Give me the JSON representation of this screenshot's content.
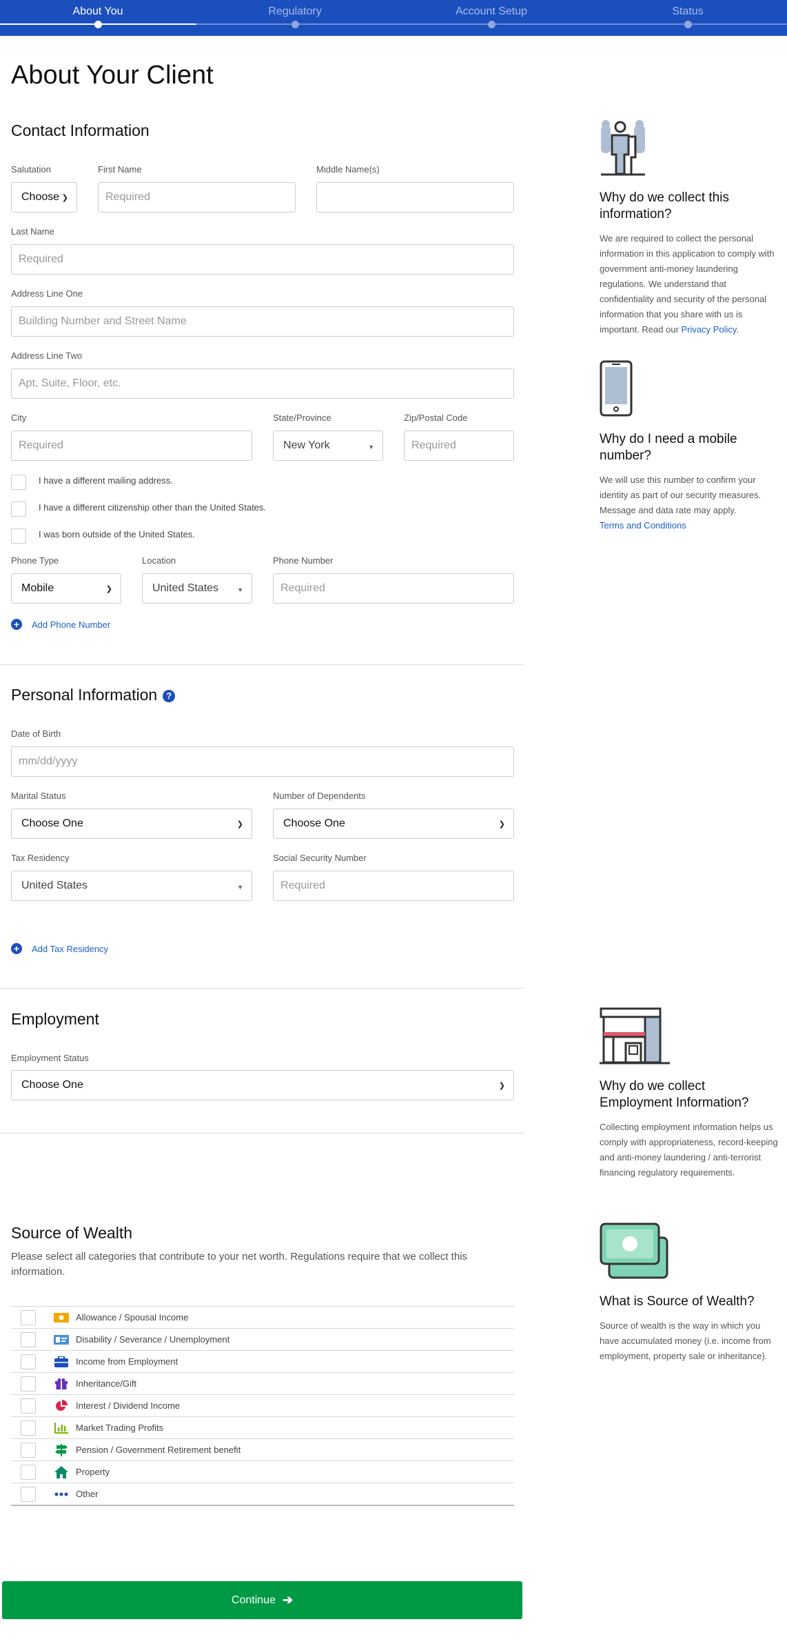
{
  "stepper": {
    "steps": [
      {
        "label": "About You",
        "active": true
      },
      {
        "label": "Regulatory",
        "active": false
      },
      {
        "label": "Account Setup",
        "active": false
      },
      {
        "label": "Status",
        "active": false
      }
    ]
  },
  "page_title": "About Your Client",
  "contact": {
    "title": "Contact Information",
    "salutation": {
      "label": "Salutation",
      "value": "Choose"
    },
    "first_name": {
      "label": "First Name",
      "placeholder": "Required"
    },
    "middle_name": {
      "label": "Middle Name(s)",
      "placeholder": ""
    },
    "last_name": {
      "label": "Last Name",
      "placeholder": "Required"
    },
    "address1": {
      "label": "Address Line One",
      "placeholder": "Building Number and Street Name"
    },
    "address2": {
      "label": "Address Line Two",
      "placeholder": "Apt, Suite, Floor, etc."
    },
    "city": {
      "label": "City",
      "placeholder": "Required"
    },
    "state": {
      "label": "State/Province",
      "value": "New York"
    },
    "zip": {
      "label": "Zip/Postal Code",
      "placeholder": "Required"
    },
    "checkboxes": [
      "I have a different mailing address.",
      "I have a different citizenship other than the United States.",
      "I was born outside of the United States."
    ],
    "phone_type": {
      "label": "Phone Type",
      "value": "Mobile"
    },
    "location": {
      "label": "Location",
      "value": "United States"
    },
    "phone_number": {
      "label": "Phone Number",
      "placeholder": "Required"
    },
    "add_phone": "Add Phone Number"
  },
  "personal": {
    "title": "Personal Information",
    "help_glyph": "?",
    "dob": {
      "label": "Date of Birth",
      "placeholder": "mm/dd/yyyy"
    },
    "marital": {
      "label": "Marital Status",
      "value": "Choose One"
    },
    "dependents": {
      "label": "Number of Dependents",
      "value": "Choose One"
    },
    "tax_residency": {
      "label": "Tax Residency",
      "value": "United States"
    },
    "ssn": {
      "label": "Social Security Number",
      "placeholder": "Required"
    },
    "add_tax": "Add Tax Residency"
  },
  "employment": {
    "title": "Employment",
    "status": {
      "label": "Employment Status",
      "value": "Choose One"
    }
  },
  "wealth": {
    "title": "Source of Wealth",
    "description": "Please select all categories that contribute to your net worth. Regulations require that we collect this information.",
    "items": [
      {
        "label": "Allowance / Spousal Income",
        "icon": "money-icon",
        "color": "#f2a900"
      },
      {
        "label": "Disability / Severance / Unemployment",
        "icon": "id-card-icon",
        "color": "#4a90d9"
      },
      {
        "label": "Income from Employment",
        "icon": "briefcase-icon",
        "color": "#1b4fbd"
      },
      {
        "label": "Inheritance/Gift",
        "icon": "gift-icon",
        "color": "#6a2fb8"
      },
      {
        "label": "Interest / Dividend Income",
        "icon": "pie-chart-icon",
        "color": "#e0234e"
      },
      {
        "label": "Market Trading Profits",
        "icon": "bar-chart-icon",
        "color": "#7ab800"
      },
      {
        "label": "Pension / Government Retirement benefit",
        "icon": "signpost-icon",
        "color": "#009a44"
      },
      {
        "label": "Property",
        "icon": "house-icon",
        "color": "#0a8a6a"
      },
      {
        "label": "Other",
        "icon": "dots-icon",
        "color": "#1b4fbd"
      }
    ]
  },
  "side": {
    "collect": {
      "title": "Why do we collect this information?",
      "body": "We are required to collect the personal information in this application to comply with government anti-money laundering regulations. We understand that confidentiality and security of the personal information that you share with us is important. Read our ",
      "link": "Privacy Policy",
      "tail": "."
    },
    "mobile": {
      "title": "Why do I need a mobile number?",
      "body": "We will use this number to confirm your identity as part of our security measures. Message and data rate may apply.",
      "link": "Terms and Conditions"
    },
    "employment": {
      "title": "Why do we collect Employment Information?",
      "body": "Collecting employment information helps us comply with appropriateness, record-keeping and anti-money laundering / anti-terrorist financing regulatory requirements."
    },
    "wealth": {
      "title": "What is Source of Wealth?",
      "body": "Source of wealth is the way in which you have accumulated money (i.e. income from employment, property sale or inheritance)."
    }
  },
  "continue_label": "Continue",
  "colors": {
    "brand": "#1b4fbd",
    "success": "#009a44",
    "link": "#1b5fc4"
  }
}
